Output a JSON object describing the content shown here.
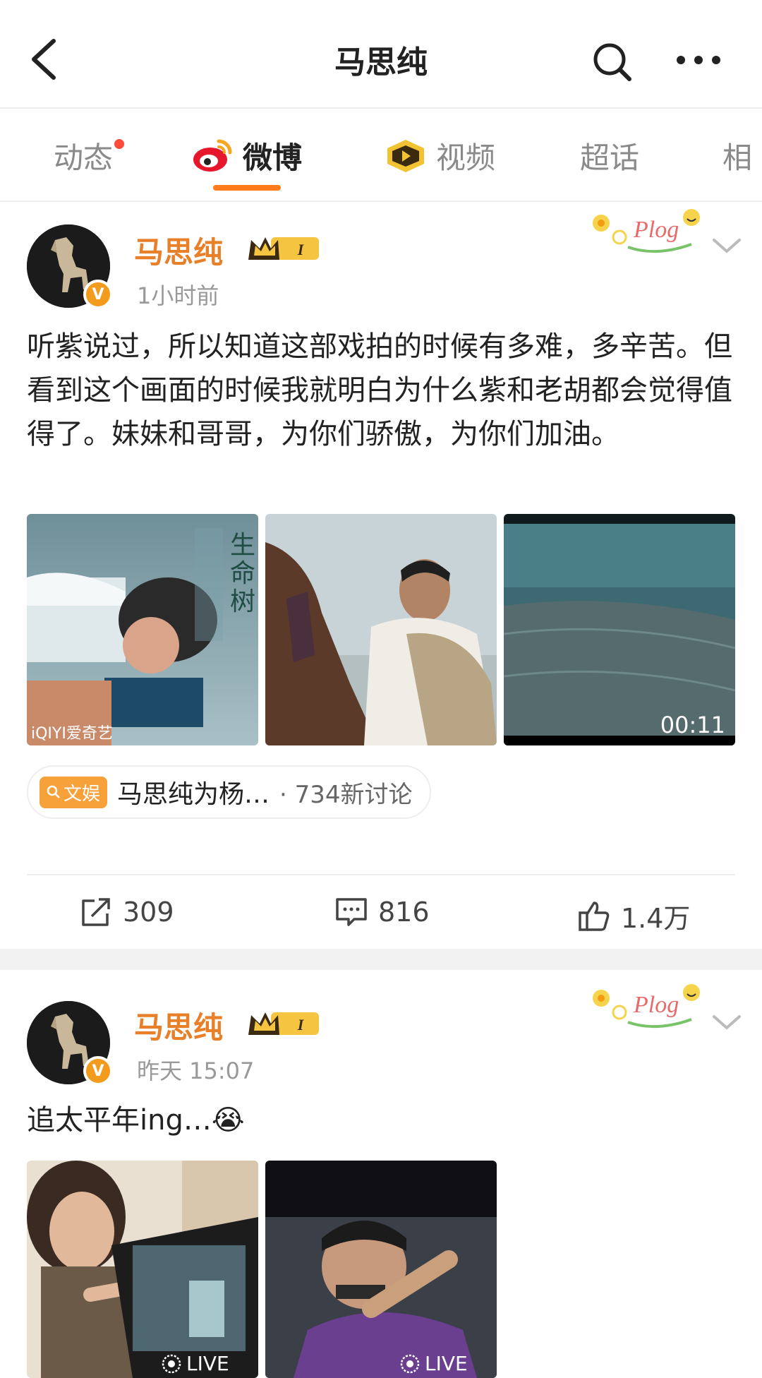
{
  "header": {
    "title": "马思纯",
    "back_icon": "back-arrow-icon",
    "search_icon": "search-icon",
    "more_icon": "more-dots-icon"
  },
  "tabs": [
    {
      "label": "动态",
      "has_dot": true
    },
    {
      "label": "微博",
      "active": true,
      "icon": "weibo-logo-icon"
    },
    {
      "label": "视频",
      "icon": "video-play-icon"
    },
    {
      "label": "超话"
    },
    {
      "label": "相"
    }
  ],
  "posts": [
    {
      "username": "马思纯",
      "level_badge": "I",
      "time": "1小时前",
      "sticker": "Plog",
      "text": "听紫说过，所以知道这部戏拍的时候有多难，多辛苦。但看到这个画面的时候我就明白为什么紫和老胡都会觉得值得了。妹妹和哥哥，为你们骄傲，为你们加油。",
      "images": [
        {
          "caption_vertical": "生命树",
          "watermark": "iQIYI爱奇艺"
        },
        {},
        {
          "duration": "00:11"
        }
      ],
      "topic": {
        "tag": "文娱",
        "title": "马思纯为杨…",
        "count": "· 734新讨论"
      },
      "actions": {
        "repost": "309",
        "comment": "816",
        "like": "1.4万"
      }
    },
    {
      "username": "马思纯",
      "level_badge": "I",
      "time": "昨天 15:07",
      "sticker": "Plog",
      "text": "追太平年ing…😭",
      "images": [
        {
          "live": "LIVE"
        },
        {
          "live": "LIVE"
        }
      ]
    }
  ],
  "colors": {
    "accent": "#ff7a1a",
    "username": "#e8802a",
    "topic_tag": "#f7a13b",
    "muted": "#999999"
  }
}
